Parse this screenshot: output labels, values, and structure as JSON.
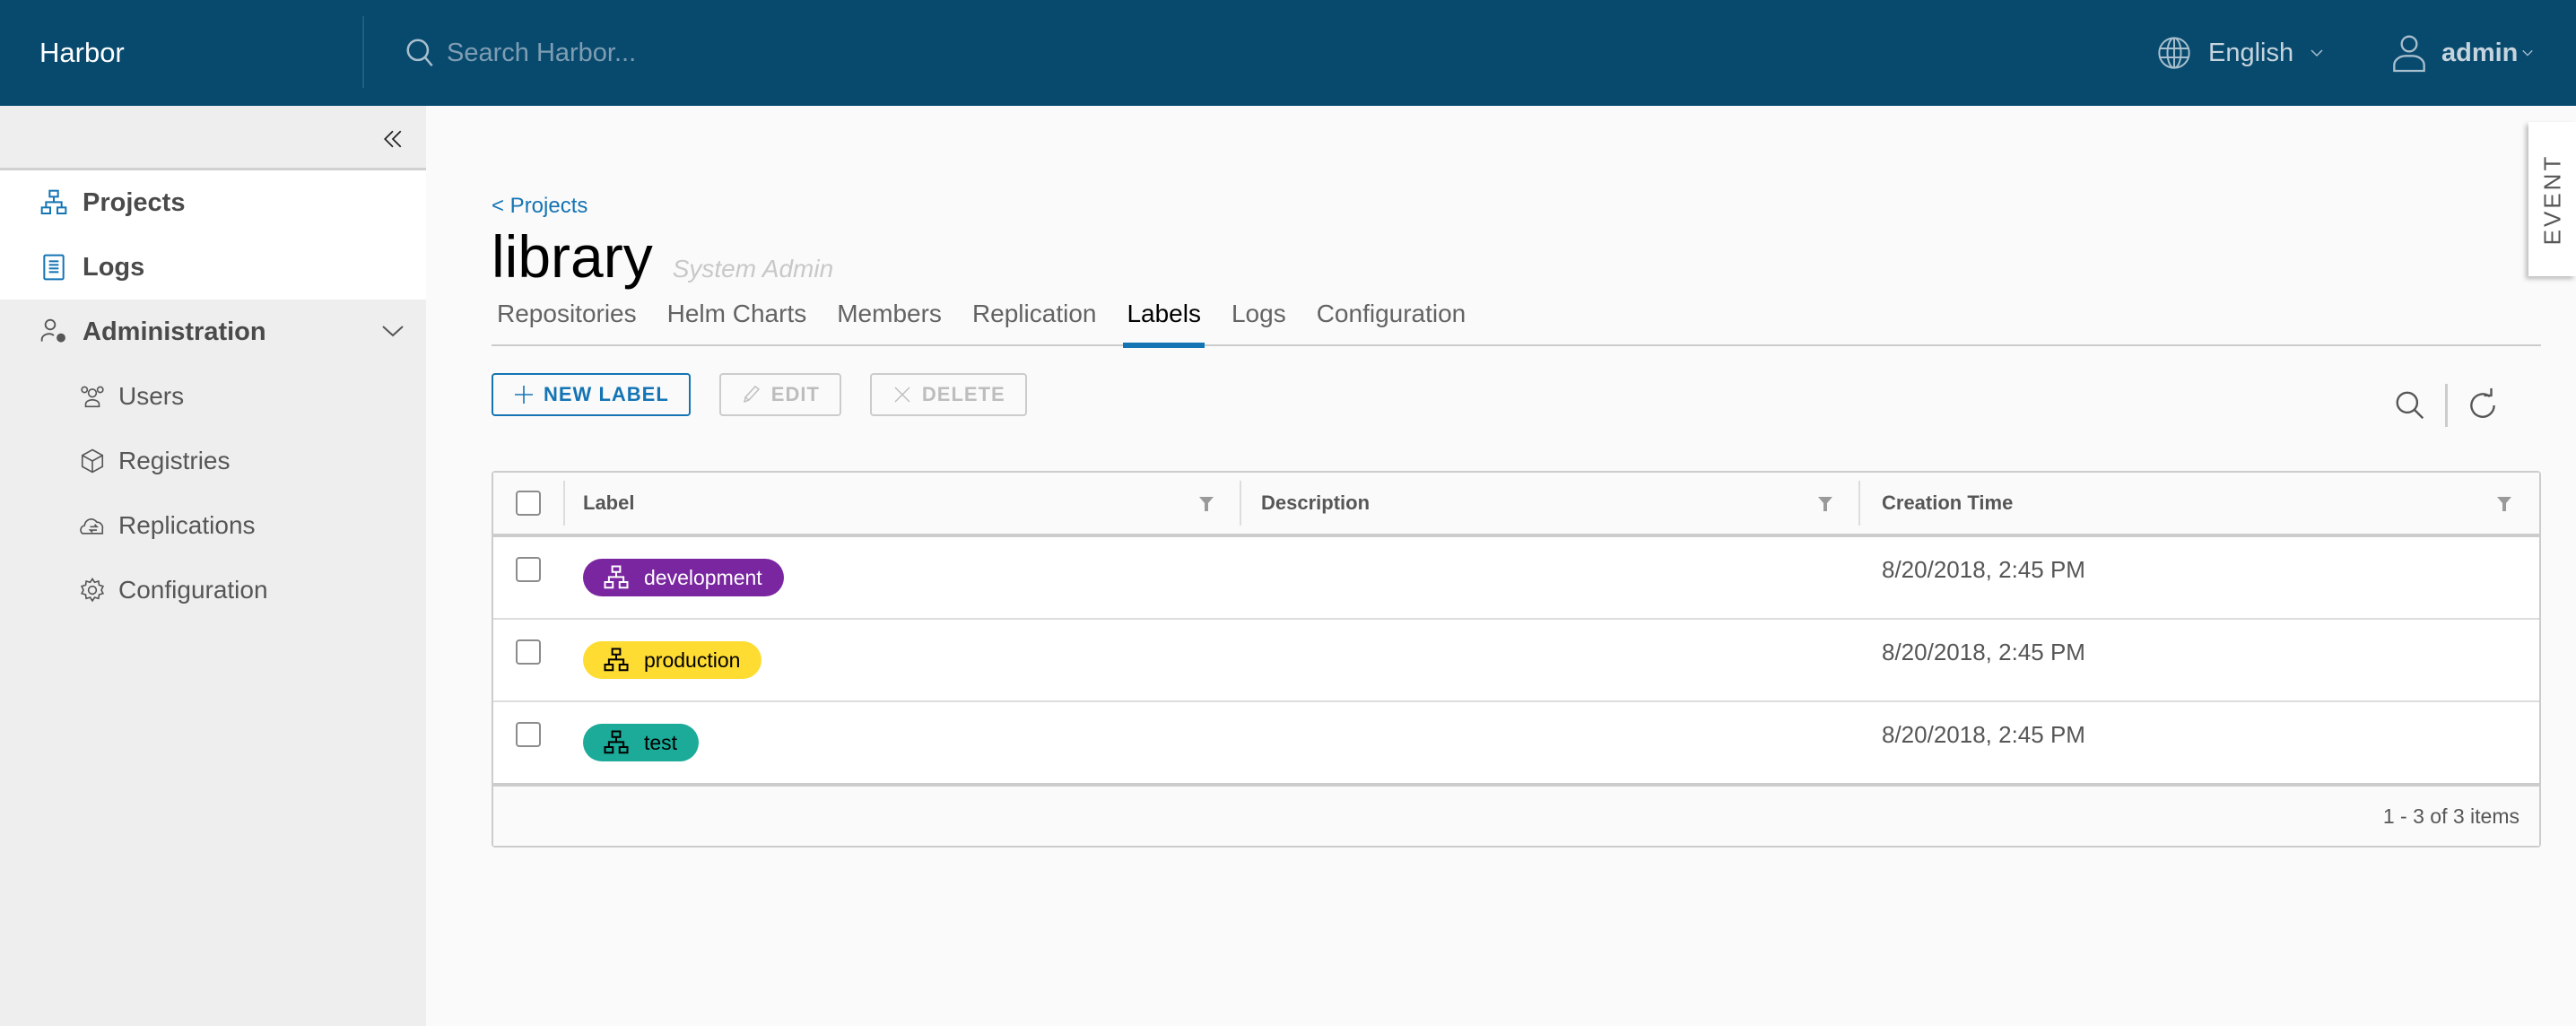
{
  "header": {
    "brand": "Harbor",
    "search_placeholder": "Search Harbor...",
    "language": "English",
    "user": "admin",
    "bg_color": "#084A6E"
  },
  "sidebar": {
    "items": [
      {
        "label": "Projects",
        "icon": "projects-icon"
      },
      {
        "label": "Logs",
        "icon": "logs-icon"
      }
    ],
    "admin_group": {
      "label": "Administration",
      "icon": "administration-icon",
      "children": [
        {
          "label": "Users",
          "icon": "users-icon"
        },
        {
          "label": "Registries",
          "icon": "registries-icon"
        },
        {
          "label": "Replications",
          "icon": "replications-icon"
        },
        {
          "label": "Configuration",
          "icon": "configuration-icon"
        }
      ]
    }
  },
  "main": {
    "breadcrumb": "< Projects",
    "title": "library",
    "role": "System Admin",
    "tabs": [
      {
        "label": "Repositories"
      },
      {
        "label": "Helm Charts"
      },
      {
        "label": "Members"
      },
      {
        "label": "Replication"
      },
      {
        "label": "Labels",
        "active": true
      },
      {
        "label": "Logs"
      },
      {
        "label": "Configuration"
      }
    ],
    "toolbar": {
      "new_label": "NEW LABEL",
      "edit": "EDIT",
      "delete": "DELETE"
    },
    "table": {
      "columns": [
        "Label",
        "Description",
        "Creation Time"
      ],
      "rows": [
        {
          "label": "development",
          "color": "#7A26A0",
          "text_color": "#FFFFFF",
          "description": "",
          "created": "8/20/2018, 2:45 PM"
        },
        {
          "label": "production",
          "color": "#FFDC32",
          "text_color": "#000000",
          "description": "",
          "created": "8/20/2018, 2:45 PM"
        },
        {
          "label": "test",
          "color": "#1BAB98",
          "text_color": "#000000",
          "description": "",
          "created": "8/20/2018, 2:45 PM"
        }
      ],
      "footer": "1 - 3 of 3 items"
    }
  },
  "event_panel": "EVENT",
  "accent_color": "#1474B4"
}
